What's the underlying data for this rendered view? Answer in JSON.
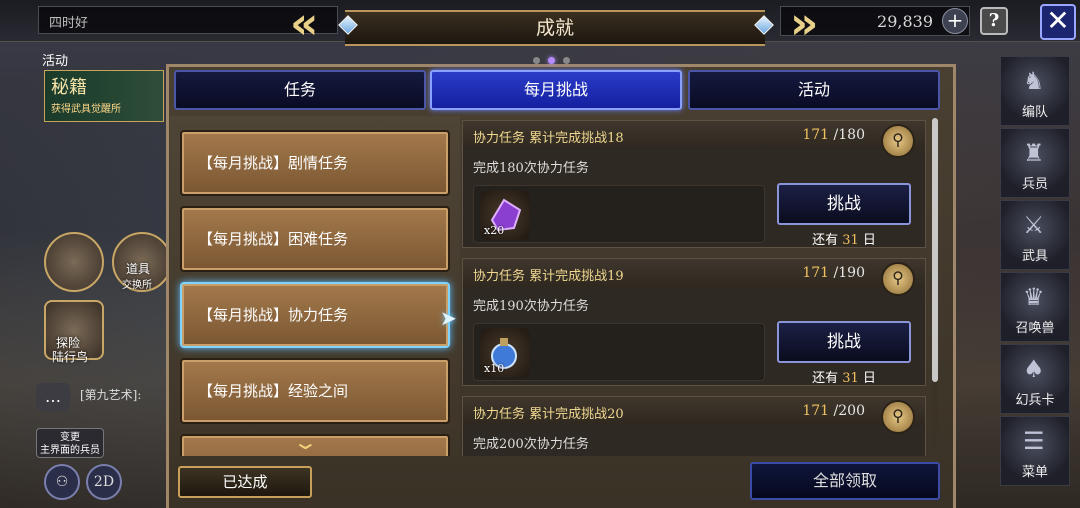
{
  "topbar": {
    "greeting": "四时好",
    "currency": "29,839",
    "plus": "+",
    "help": "?",
    "close": "✕"
  },
  "title": {
    "text": "成就",
    "page_dots": 3,
    "active_dot": 2
  },
  "background": {
    "event_label": "活动",
    "event_banner": "秘籍",
    "event_sub": "获得武具觉醒所",
    "item_exchange": "道具",
    "item_exchange_sub": "交换所",
    "explore": "探险",
    "explore_sub": "陆行鸟",
    "chat_text": "[第九艺术]:",
    "switch_label_1": "变更",
    "switch_label_2": "主界面的兵员",
    "btn_2d": "2D"
  },
  "right_nav": [
    {
      "label": "编队",
      "icon": "party-icon"
    },
    {
      "label": "兵员",
      "icon": "unit-icon"
    },
    {
      "label": "武具",
      "icon": "weapon-icon"
    },
    {
      "label": "召唤兽",
      "icon": "summon-icon"
    },
    {
      "label": "幻兵卡",
      "icon": "card-icon"
    },
    {
      "label": "菜单",
      "icon": "menu-icon"
    }
  ],
  "tabs": [
    {
      "label": "任务",
      "active": false
    },
    {
      "label": "每月挑战",
      "active": true
    },
    {
      "label": "活动",
      "active": false
    }
  ],
  "categories": [
    {
      "label": "【每月挑战】剧情任务",
      "selected": false
    },
    {
      "label": "【每月挑战】困难任务",
      "selected": false
    },
    {
      "label": "【每月挑战】协力任务",
      "selected": true
    },
    {
      "label": "【每月挑战】经验之间",
      "selected": false
    }
  ],
  "tasks": [
    {
      "title": "协力任务 累计完成挑战18",
      "current": "171",
      "total": "/180",
      "description": "完成180次协力任务",
      "reward_qty": "x20",
      "reward_icon": "purple-crystal-icon",
      "button": "挑战",
      "remain_prefix": "还有",
      "remain_days": "31",
      "remain_suffix": "日"
    },
    {
      "title": "协力任务 累计完成挑战19",
      "current": "171",
      "total": "/190",
      "description": "完成190次协力任务",
      "reward_qty": "x10",
      "reward_icon": "blue-potion-icon",
      "button": "挑战",
      "remain_prefix": "还有",
      "remain_days": "31",
      "remain_suffix": "日"
    },
    {
      "title": "协力任务 累计完成挑战20",
      "current": "171",
      "total": "/200",
      "description": "完成200次协力任务"
    }
  ],
  "footer": {
    "achieved": "已达成",
    "claim_all": "全部领取"
  },
  "colors": {
    "accent_gold": "#f0c060",
    "tab_active": "#2b3cc8",
    "selection_glow": "#7fd4ff"
  }
}
